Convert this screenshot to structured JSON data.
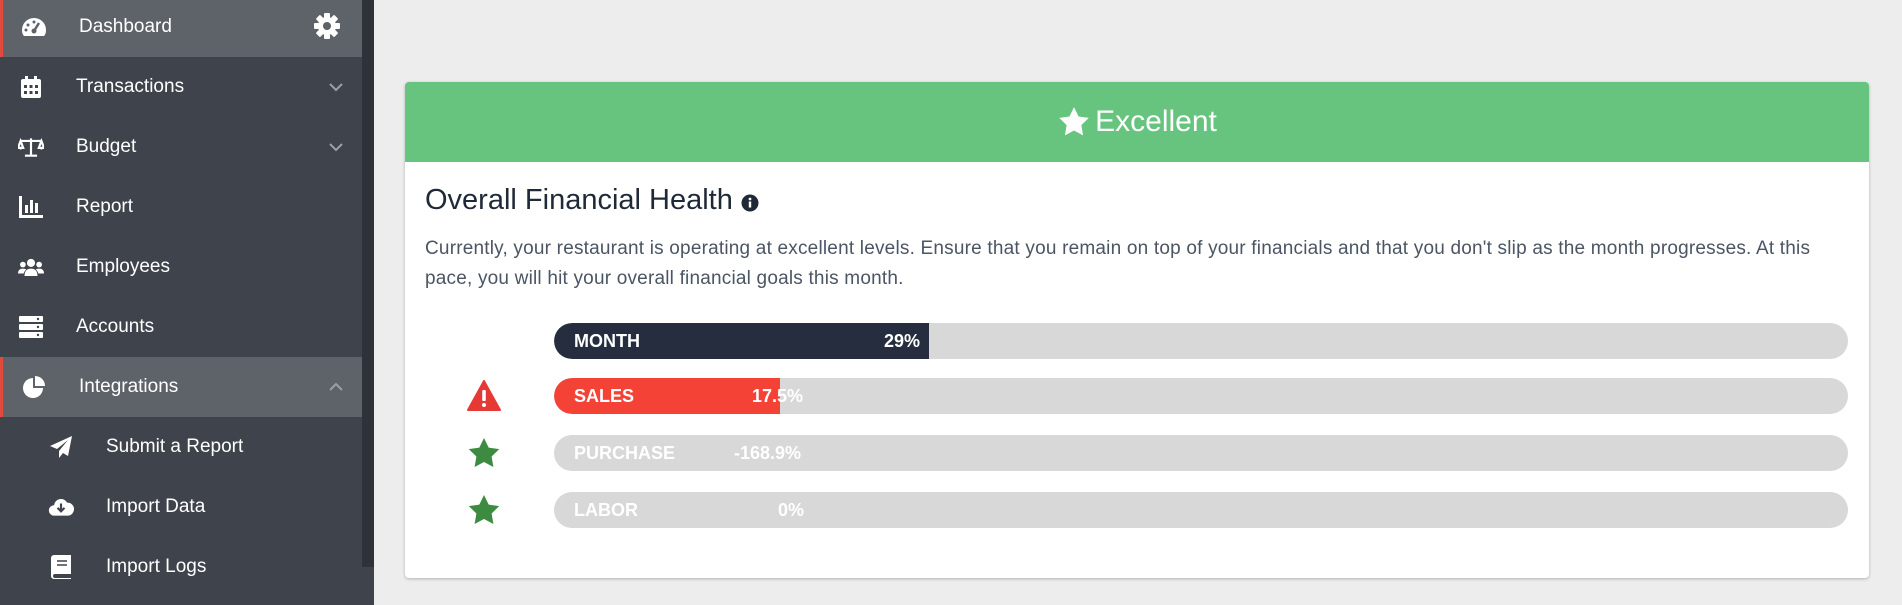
{
  "sidebar": {
    "items": [
      {
        "label": "Dashboard",
        "icon": "dashboard-gauge-icon",
        "active": true
      },
      {
        "label": "Transactions",
        "icon": "calendar-icon"
      },
      {
        "label": "Budget",
        "icon": "balance-scale-icon"
      },
      {
        "label": "Report",
        "icon": "bar-chart-icon"
      },
      {
        "label": "Employees",
        "icon": "users-icon"
      },
      {
        "label": "Accounts",
        "icon": "server-icon"
      },
      {
        "label": "Integrations",
        "icon": "pie-chart-icon",
        "expanded": true
      }
    ],
    "subitems": [
      {
        "label": "Submit a Report",
        "icon": "paper-plane-icon"
      },
      {
        "label": "Import Data",
        "icon": "cloud-download-icon"
      },
      {
        "label": "Import Logs",
        "icon": "book-icon"
      }
    ]
  },
  "banner": {
    "label": "Excellent",
    "color": "#66c47f"
  },
  "health": {
    "title": "Overall Financial Health",
    "description": "Currently, your restaurant is operating at excellent levels. Ensure that you remain on top of your financials and that you don't slip as the month progresses. At this pace, you will hit your overall financial goals this month."
  },
  "bars": [
    {
      "name": "MONTH",
      "value": "29%",
      "fill_fraction": 0.29,
      "color": "#252d3f",
      "icon": ""
    },
    {
      "name": "SALES",
      "value": "17.5%",
      "fill_fraction": 0.175,
      "color": "#f44336",
      "icon": "warning-icon"
    },
    {
      "name": "PURCHASE",
      "value": "-168.9%",
      "fill_fraction": 0,
      "color": "#d8d8d8",
      "icon": "star-icon"
    },
    {
      "name": "LABOR",
      "value": "0%",
      "fill_fraction": 0,
      "color": "#d8d8d8",
      "icon": "star-icon"
    }
  ]
}
